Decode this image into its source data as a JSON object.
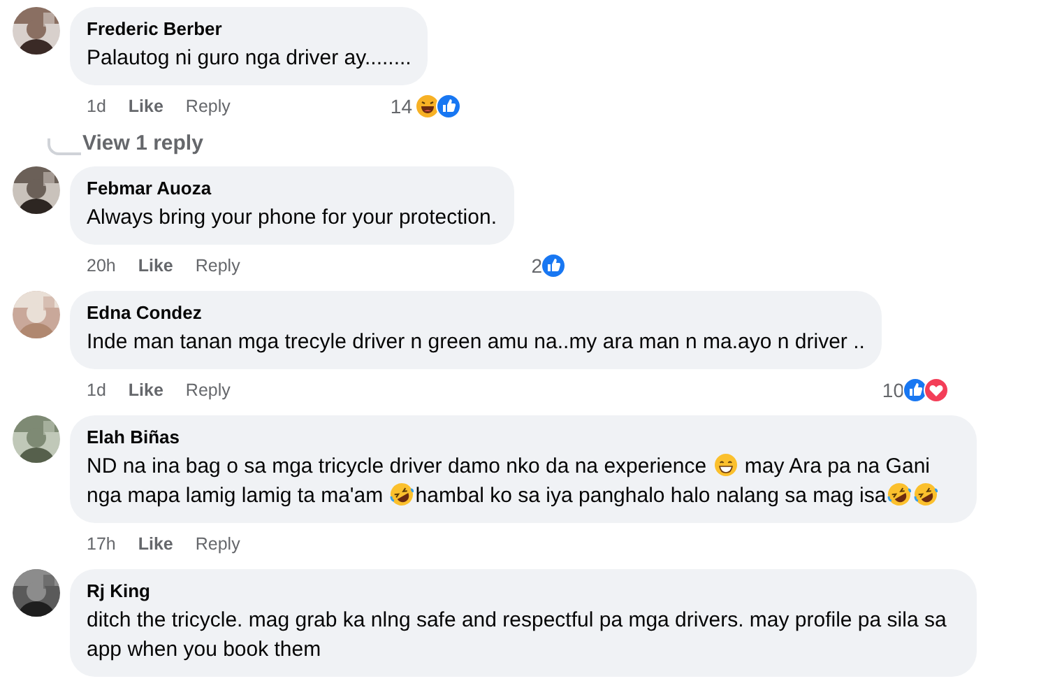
{
  "comments": [
    {
      "name": "Frederic Berber",
      "avatar": {
        "kind": "picture"
      },
      "segments": [
        {
          "kind": "text",
          "text": "Palautog ni guro nga driver ay........"
        }
      ],
      "time": "1d",
      "like": "Like",
      "reply": "Reply",
      "count": "14",
      "reactions": [
        {
          "kind": "haha"
        },
        {
          "kind": "like"
        }
      ],
      "view_replies": "View 1 reply"
    },
    {
      "name": "Febmar Auoza",
      "avatar": {
        "kind": "picture"
      },
      "segments": [
        {
          "kind": "text",
          "text": "Always bring your phone for your protection."
        }
      ],
      "time": "20h",
      "like": "Like",
      "reply": "Reply",
      "count": "2",
      "reactions": [
        {
          "kind": "like"
        }
      ]
    },
    {
      "name": "Edna Condez",
      "avatar": {
        "kind": "picture"
      },
      "segments": [
        {
          "kind": "text",
          "text": "Inde man tanan mga trecyle driver n green amu na..my ara man n ma.ayo n driver .."
        }
      ],
      "time": "1d",
      "like": "Like",
      "reply": "Reply",
      "count": "10",
      "reactions": [
        {
          "kind": "like"
        },
        {
          "kind": "love"
        }
      ]
    },
    {
      "name": "Elah Biñas",
      "avatar": {
        "kind": "picture"
      },
      "segments": [
        {
          "kind": "text",
          "text": "ND na ina bag o sa mga tricycle driver damo nko da na experience "
        },
        {
          "kind": "grin"
        },
        {
          "kind": "text",
          "text": " may Ara pa na Gani nga mapa lamig lamig ta ma'am "
        },
        {
          "kind": "rofl"
        },
        {
          "kind": "text",
          "text": "hambal ko sa iya panghalo halo nalang sa mag isa"
        },
        {
          "kind": "rofl"
        },
        {
          "kind": "rofl"
        }
      ],
      "time": "17h",
      "like": "Like",
      "reply": "Reply"
    },
    {
      "name": "Rj King",
      "avatar": {
        "kind": "picture"
      },
      "segments": [
        {
          "kind": "text",
          "text": "ditch the tricycle. mag grab ka nlng safe and respectful pa mga drivers. may profile pa sila sa app when you book them"
        }
      ]
    }
  ]
}
